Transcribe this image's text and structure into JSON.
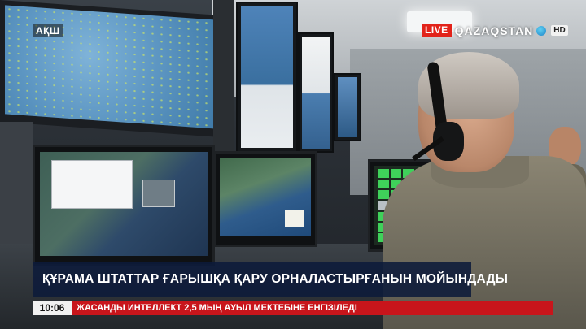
{
  "channel": {
    "live_label": "LIVE",
    "name": "QAZAQSTAN",
    "hd_label": "HD",
    "icon": "globe-icon",
    "live_color": "#e2231a"
  },
  "location_tag": "АҚШ",
  "headline": "ҚҰРАМА ШТАТТАР ҒАРЫШҚА ҚАРУ ОРНАЛАСТЫРҒАНЫН МОЙЫНДАДЫ",
  "ticker": {
    "time": "10:06",
    "text": "ЖАСАНДЫ ИНТЕЛЛЕКТ 2,5 МЫҢ АУЫЛ МЕКТЕБІНЕ ЕНГІЗІЛЕДІ",
    "color": "#c8151b"
  },
  "headline_bar_color": "#0c1a3a"
}
